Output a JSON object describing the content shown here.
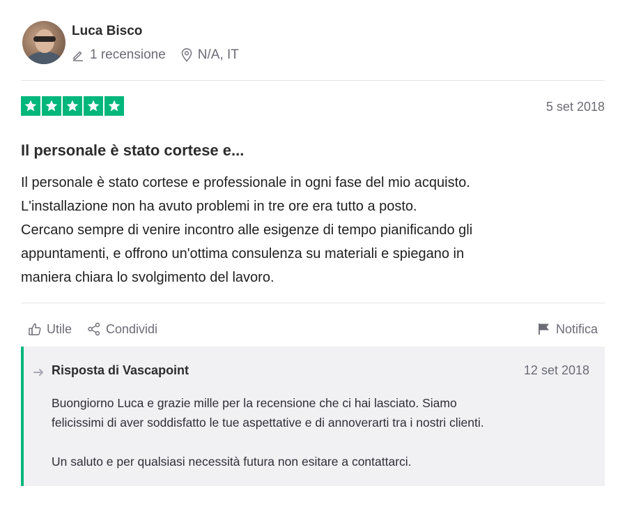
{
  "reviewer": {
    "name": "Luca Bisco",
    "review_count": "1 recensione",
    "location": "N/A, IT"
  },
  "review": {
    "rating": 5,
    "max_rating": 5,
    "date": "5 set 2018",
    "title": "Il personale è stato cortese e...",
    "body_lines": [
      "Il personale è stato cortese e professionale in ogni fase del mio acquisto.",
      "L'installazione non ha avuto problemi in tre ore era tutto a posto.",
      "Cercano sempre di venire incontro alle esigenze di tempo pianificando gli",
      "appuntamenti, e offrono un'ottima consulenza su materiali e spiegano in",
      "maniera chiara lo svolgimento del lavoro."
    ]
  },
  "actions": {
    "useful_label": "Utile",
    "share_label": "Condividi",
    "report_label": "Notifica"
  },
  "reply": {
    "from": "Risposta di Vascapoint",
    "date": "12 set 2018",
    "paragraph_1_lines": [
      "Buongiorno Luca e grazie mille per la recensione che ci hai lasciato. Siamo",
      "felicissimi di aver soddisfatto le tue aspettative e di annoverarti tra i nostri clienti."
    ],
    "paragraph_2": "Un saluto e per qualsiasi necessità futura non esitare a contattarci."
  },
  "colors": {
    "star_green": "#00b67a",
    "muted_text": "#6b6b75",
    "reply_background": "#f1f1f4"
  },
  "icons": [
    "pencil-icon",
    "location-pin-icon",
    "star-icon",
    "thumbs-up-icon",
    "share-icon",
    "flag-icon",
    "reply-arrow-icon"
  ]
}
